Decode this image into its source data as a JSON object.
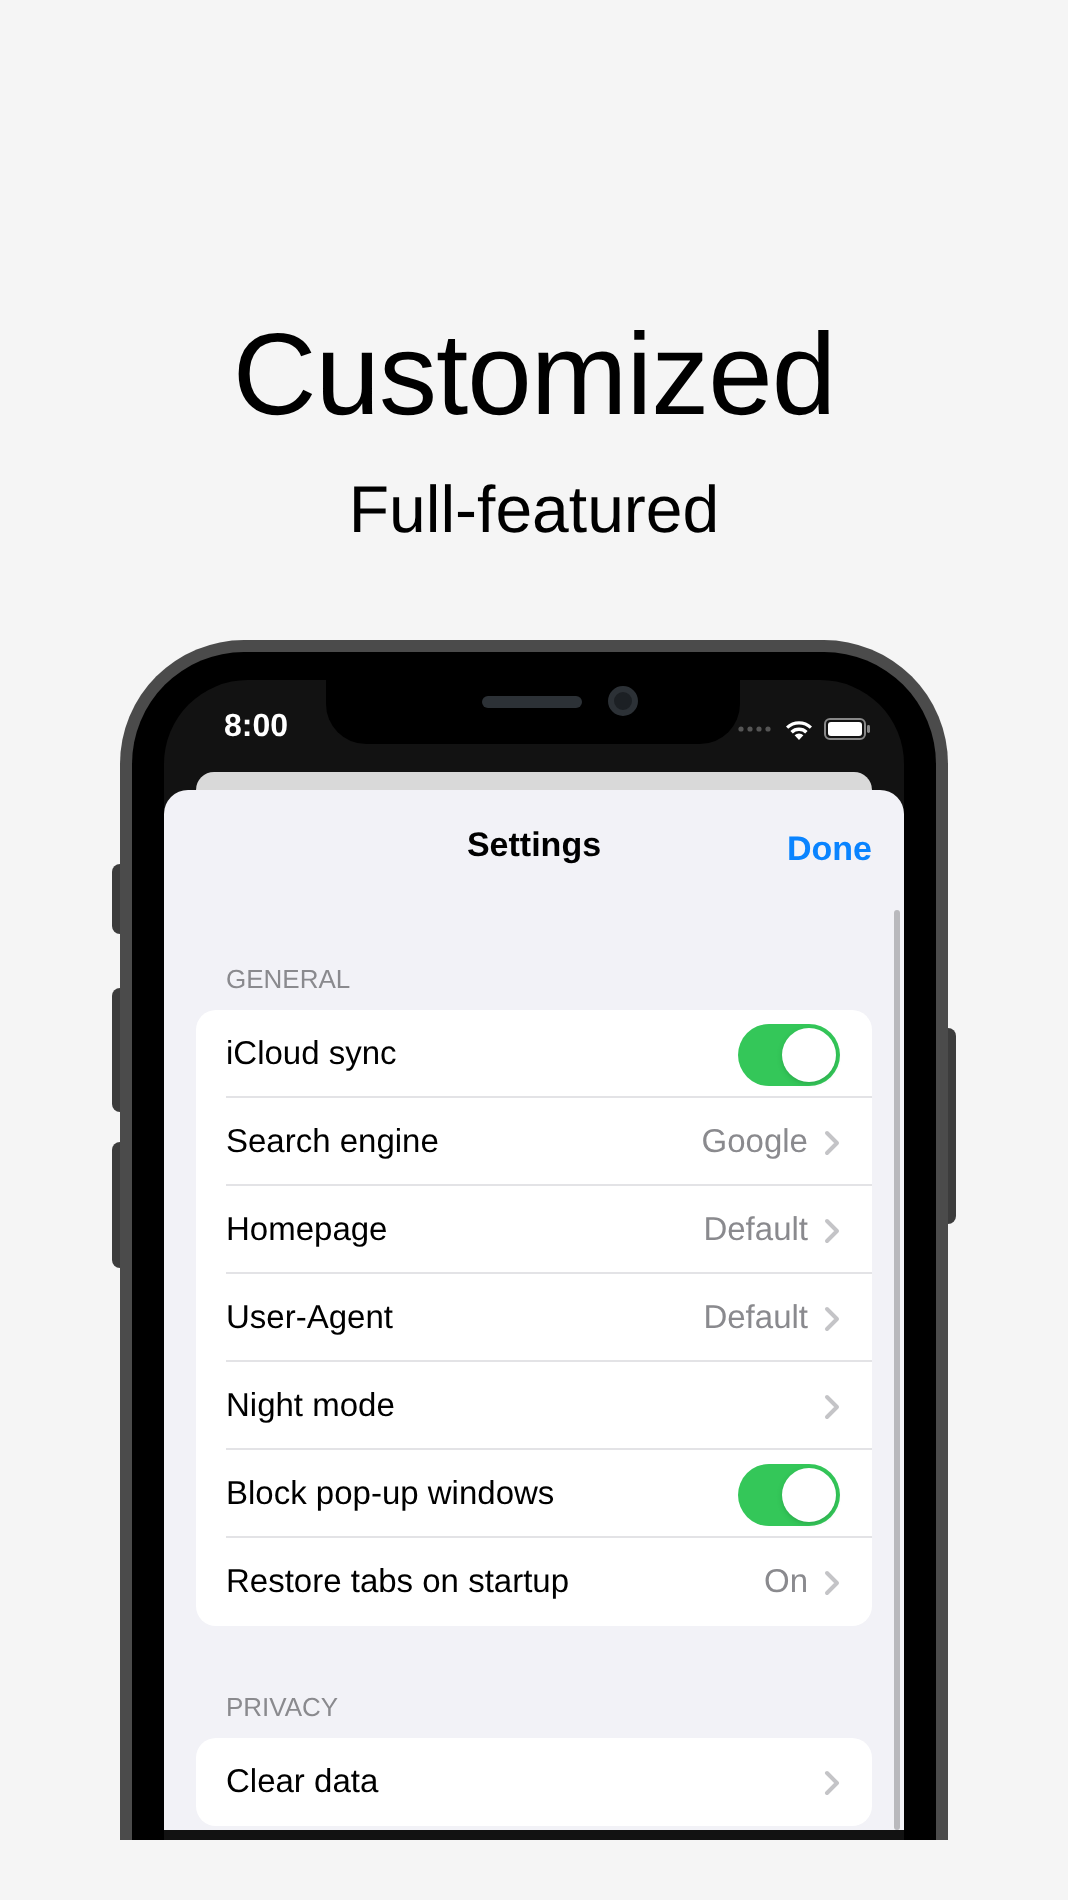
{
  "headline": "Customized",
  "subheadline": "Full-featured",
  "status_bar": {
    "time": "8:00"
  },
  "sheet": {
    "title": "Settings",
    "done": "Done"
  },
  "sections": [
    {
      "header": "GENERAL",
      "rows": [
        {
          "kind": "toggle",
          "label": "iCloud sync",
          "on": true
        },
        {
          "kind": "link",
          "label": "Search engine",
          "value": "Google"
        },
        {
          "kind": "link",
          "label": "Homepage",
          "value": "Default"
        },
        {
          "kind": "link",
          "label": "User-Agent",
          "value": "Default"
        },
        {
          "kind": "link",
          "label": "Night mode"
        },
        {
          "kind": "toggle",
          "label": "Block pop-up windows",
          "on": true
        },
        {
          "kind": "link",
          "label": "Restore tabs on startup",
          "value": "On"
        }
      ]
    },
    {
      "header": "PRIVACY",
      "rows": [
        {
          "kind": "link",
          "label": "Clear data"
        }
      ]
    }
  ]
}
